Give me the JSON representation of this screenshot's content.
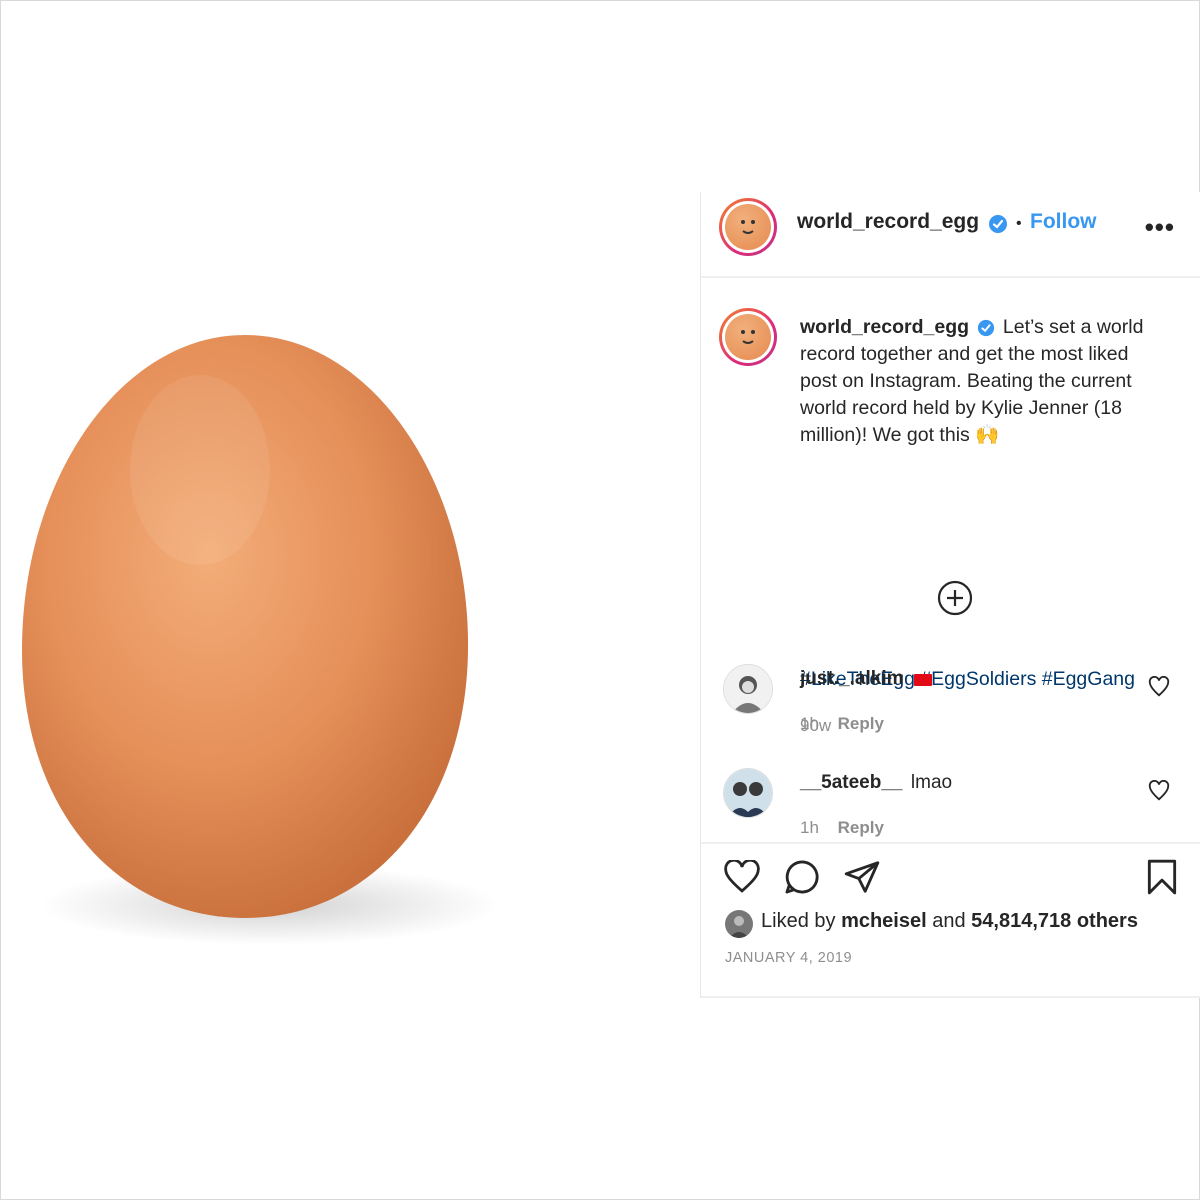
{
  "post": {
    "username": "world_record_egg",
    "follow_label": "Follow",
    "separator": "•",
    "more_label": "•••",
    "caption": "Let’s set a world record together and get the most liked post on Instagram. Beating the current world record held by Kylie Jenner (18 million)! We got this 🙌",
    "hashtags": "#LikeTheEgg #EggSoldiers #EggGang",
    "age": "90w"
  },
  "comments": [
    {
      "username": "just._.alkim",
      "text": "",
      "time": "1h",
      "reply_label": "Reply"
    },
    {
      "username": "__5ateeb__",
      "text": "lmao",
      "time": "1h",
      "reply_label": "Reply"
    }
  ],
  "footer": {
    "liked_prefix": "Liked by",
    "liked_user": "mcheisel",
    "liked_mid": "and",
    "liked_count": "54,814,718 others",
    "date": "JANUARY 4, 2019"
  },
  "colors": {
    "egg": "#e58a50",
    "link_blue": "#3897f0",
    "hashtag": "#00376b",
    "muted": "#8e8e8e"
  }
}
